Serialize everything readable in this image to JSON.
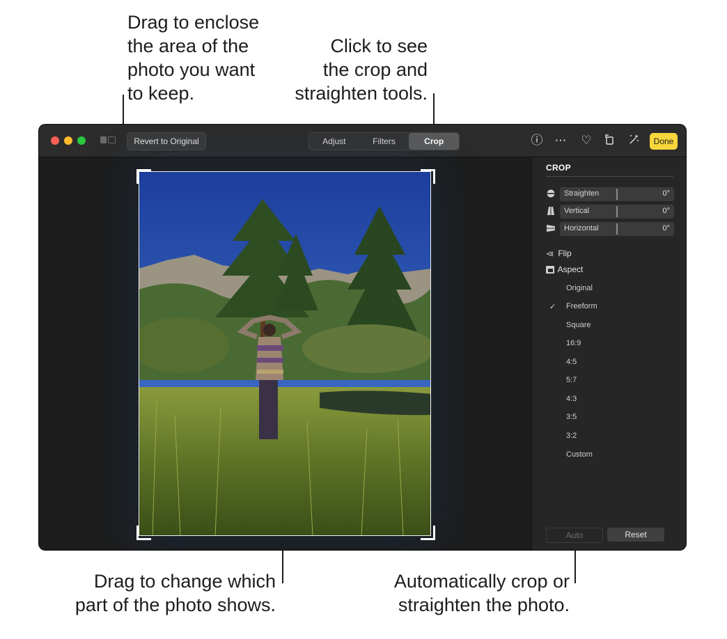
{
  "callouts": {
    "crop_area": [
      "Drag to enclose",
      "the area of the",
      "photo you want",
      "to keep."
    ],
    "crop_tab": [
      "Click to see",
      "the crop and",
      "straighten tools."
    ],
    "drag_photo": [
      "Drag to change which",
      "part of the photo shows."
    ],
    "auto": [
      "Automatically crop or",
      "straighten the photo."
    ]
  },
  "toolbar": {
    "revert_label": "Revert to Original",
    "tabs": [
      {
        "label": "Adjust",
        "active": false
      },
      {
        "label": "Filters",
        "active": false
      },
      {
        "label": "Crop",
        "active": true
      }
    ],
    "icons": [
      "info-icon",
      "more-icon",
      "heart-icon",
      "rotate-icon",
      "magic-wand-icon"
    ],
    "done_label": "Done",
    "colors": {
      "close": "#ff5f57",
      "minimize": "#febc2e",
      "zoom": "#28c840",
      "done": "#f7d63b"
    }
  },
  "inspector": {
    "section_title": "CROP",
    "sliders": [
      {
        "label": "Straighten",
        "value": "0°",
        "icon": "straighten-icon"
      },
      {
        "label": "Vertical",
        "value": "0°",
        "icon": "vertical-icon"
      },
      {
        "label": "Horizontal",
        "value": "0°",
        "icon": "horizontal-icon"
      }
    ],
    "flip_label": "Flip",
    "aspect_label": "Aspect",
    "aspects": [
      "Original",
      "Freeform",
      "Square",
      "16:9",
      "4:5",
      "5:7",
      "4:3",
      "3:5",
      "3:2",
      "Custom"
    ],
    "selected_aspect": "Freeform",
    "auto_label": "Auto",
    "reset_label": "Reset"
  }
}
